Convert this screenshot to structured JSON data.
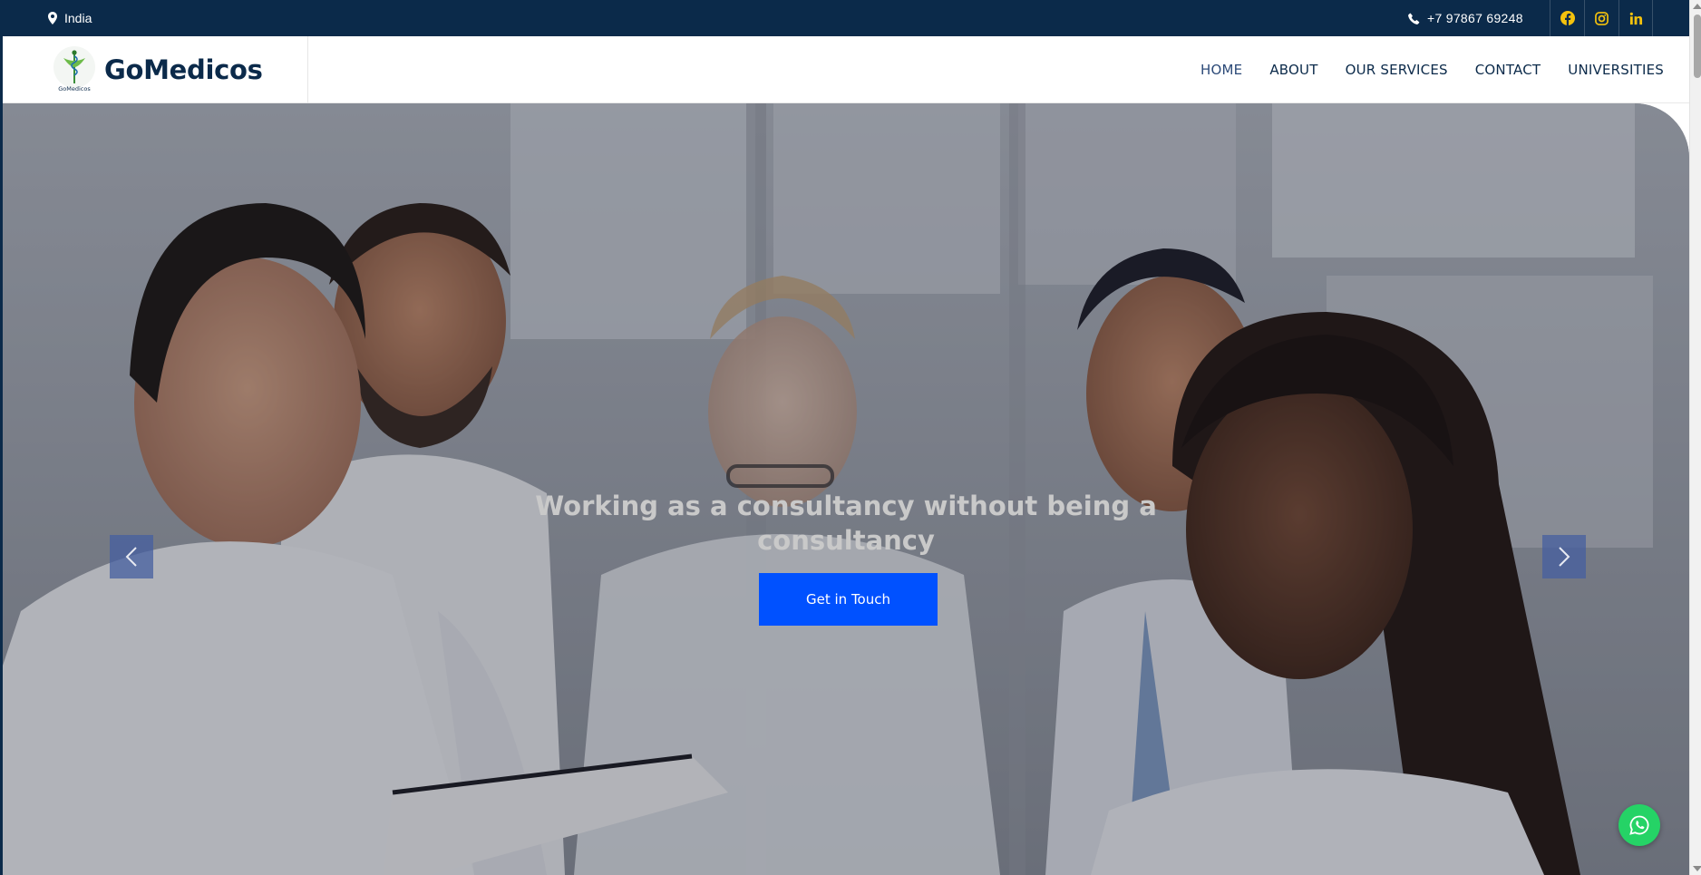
{
  "topbar": {
    "location": "India",
    "phone": "+7 97867 69248",
    "socials": [
      {
        "name": "facebook",
        "icon": "facebook-icon"
      },
      {
        "name": "instagram",
        "icon": "instagram-icon"
      },
      {
        "name": "linkedin",
        "icon": "linkedin-icon"
      }
    ]
  },
  "brand": {
    "name": "GoMedicos",
    "logo_text": "GoMedicos"
  },
  "nav": {
    "items": [
      {
        "label": "HOME",
        "active": true
      },
      {
        "label": "ABOUT",
        "active": false
      },
      {
        "label": "OUR SERVICES",
        "active": false
      },
      {
        "label": "CONTACT",
        "active": false
      },
      {
        "label": "UNIVERSITIES",
        "active": false
      }
    ]
  },
  "hero": {
    "title": "Working as a consultancy without being a consultancy",
    "cta_label": "Get in Touch"
  },
  "colors": {
    "topbar_bg": "#0b2a4a",
    "brand_text": "#0b2a4a",
    "social_icon": "#f4c20d",
    "cta_bg": "#0051ff",
    "arrow_bg": "#465fa0",
    "whatsapp": "#25d366"
  }
}
